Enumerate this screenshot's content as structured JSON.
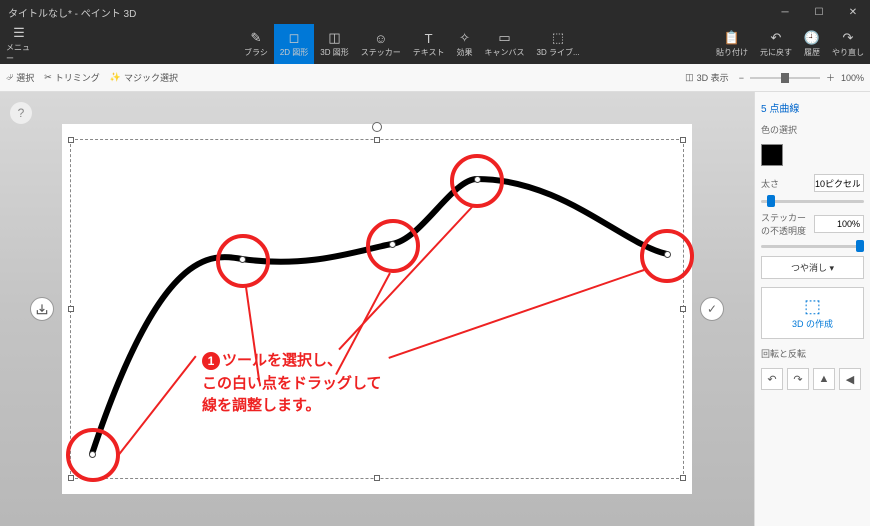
{
  "title": "タイトルなし* - ペイント 3D",
  "menubar": {
    "menu": "メニュー",
    "brush": "ブラシ",
    "shapes2d": "2D 図形",
    "shapes3d": "3D 図形",
    "sticker": "ステッカー",
    "text": "テキスト",
    "effects": "効果",
    "canvas": "キャンバス",
    "library3d": "3D ライブ...",
    "paste": "貼り付け",
    "undo": "元に戻す",
    "history": "履歴",
    "redo": "やり直し"
  },
  "secondbar": {
    "select": "選択",
    "trimming": "トリミング",
    "magic": "マジック選択",
    "view3d": "3D 表示",
    "zoom": "100%"
  },
  "sidebar": {
    "title": "5 点曲線",
    "color_label": "色の選択",
    "thickness_label": "太さ",
    "thickness_value": "10ピクセル",
    "opacity_label": "ステッカーの不透明度",
    "opacity_value": "100%",
    "matte": "つや消し",
    "make3d": "3D の作成",
    "rotate_label": "回転と反転"
  },
  "annotation": {
    "line1_prefix": "ツールを選択し、",
    "line2": "この白い点をドラッグして",
    "line3": "線を調整します。"
  },
  "icons": {
    "help": "?",
    "stamp_left": "✓",
    "stamp_right": "✓",
    "minus": "−",
    "plus": "＋"
  }
}
